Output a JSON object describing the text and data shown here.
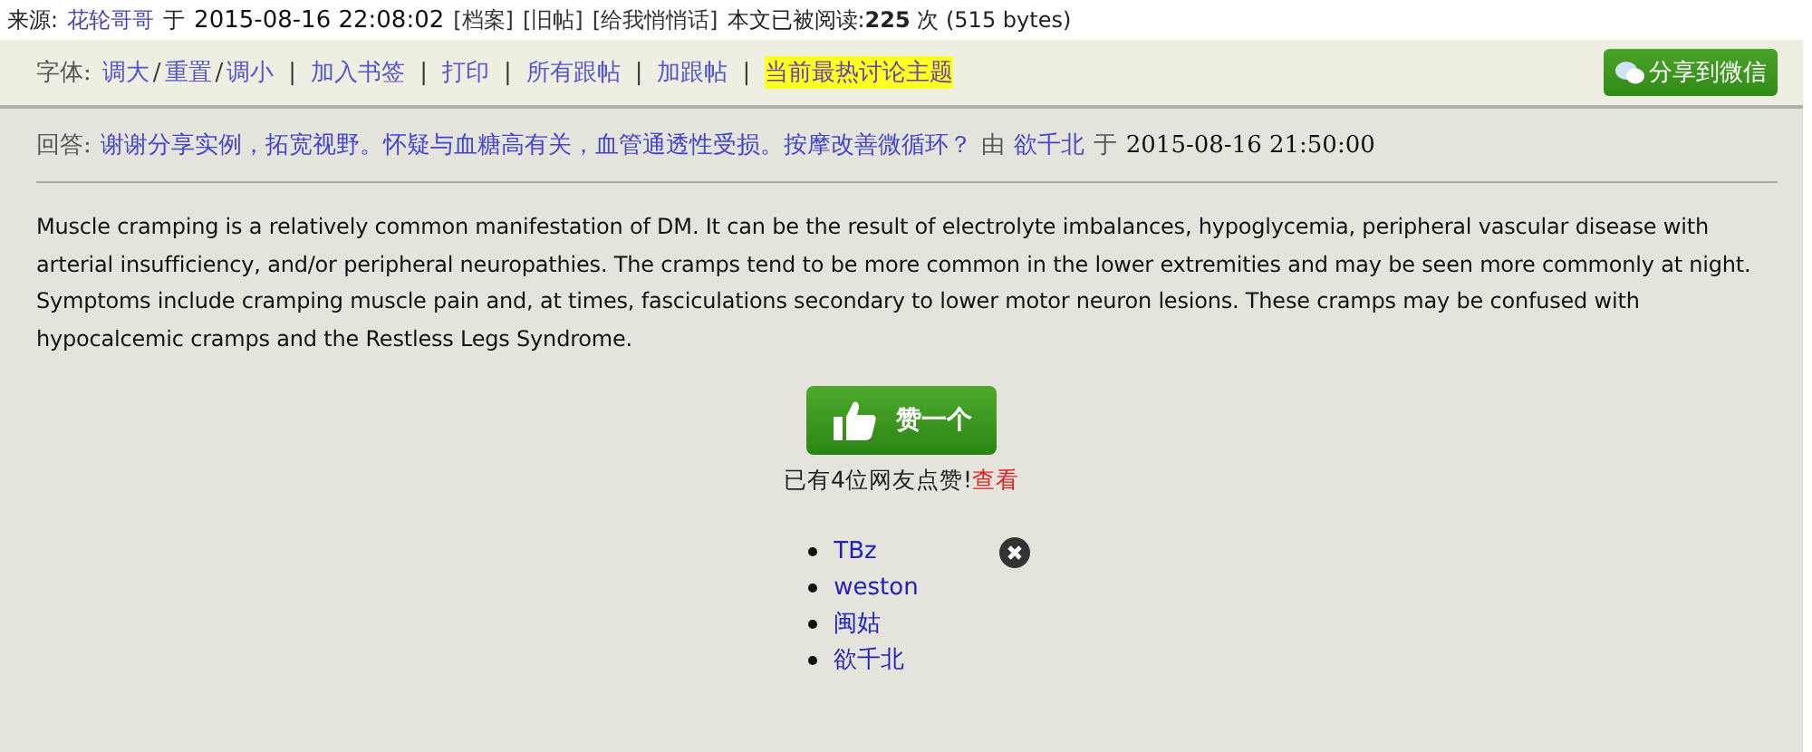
{
  "source": {
    "label": "来源:",
    "author": "花轮哥哥",
    "at": "于",
    "time": "2015-08-16 22:08:02",
    "links": [
      "[档案]",
      "[旧帖]",
      "[给我悄悄话]"
    ],
    "reads_label": "本文已被阅读:",
    "reads": "225",
    "reads_unit": "次",
    "size": "(515 bytes)"
  },
  "toolbar": {
    "font_label": "字体:",
    "font_links": [
      "调大",
      "重置",
      "调小"
    ],
    "font_separator": "/",
    "separator": "|",
    "links": [
      {
        "label": "加入书签",
        "highlighted": false
      },
      {
        "label": "打印",
        "highlighted": false
      },
      {
        "label": "所有跟帖",
        "highlighted": false
      },
      {
        "label": "加跟帖",
        "highlighted": false
      },
      {
        "label": "当前最热讨论主题",
        "highlighted": true
      }
    ],
    "share_button": "分享到微信"
  },
  "reply": {
    "label": "回答:",
    "title": "谢谢分享实例，拓宽视野。怀疑与血糖高有关，血管通透性受损。按摩改善微循环？",
    "by": "由",
    "author": "欲千北",
    "at": "于",
    "time": "2015-08-16 21:50:00"
  },
  "body": "Muscle cramping is a relatively common manifestation of DM. It can be the result of electrolyte imbalances, hypoglycemia, peripheral vascular disease with arterial insufficiency, and/or peripheral neuropathies. The cramps tend to be more common in the lower extremities and may be seen more commonly at night. Symptoms include cramping muscle pain and, at times, fasciculations secondary to lower motor neuron lesions. These cramps may be confused with hypocalcemic cramps and the Restless Legs Syndrome.",
  "like": {
    "button": "赞一个",
    "count_text": "已有4位网友点赞!",
    "view_link": "查看"
  },
  "likers": [
    "TBz",
    "weston",
    "闽姑",
    "欲千北"
  ]
}
